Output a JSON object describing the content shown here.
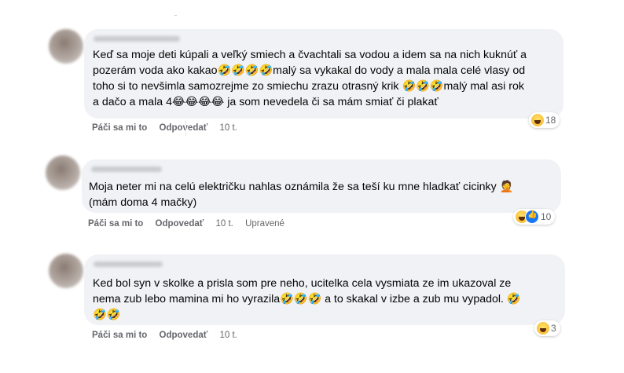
{
  "comments": [
    {
      "text": "Keď sa moje deti kúpali a veľký smiech a čvachtali sa vodou a idem sa na nich kuknúť a\npozerám voda ako kakao🤣🤣🤣🤣malý sa vykakal do vody a mala mala celé vlasy od\ntoho si to nevšimla samozrejme zo smiechu zrazu otrasný krik 🤣🤣🤣malý mal asi rok\na dačo a mala 4😂😂😂😂 ja som nevedela či sa mám smiať či plakať",
      "like_label": "Páči sa mi to",
      "reply_label": "Odpovedať",
      "time": "10 t.",
      "edited": "",
      "reaction_icons": [
        "haha-icon"
      ],
      "reaction_count": "18"
    },
    {
      "text": "Moja neter mi na celú električku nahlas oznámila že sa teší ku mne hladkať cicinky 🤦\n(mám doma 4 mačky)",
      "like_label": "Páči sa mi to",
      "reply_label": "Odpovedať",
      "time": "10 t.",
      "edited": "Upravené",
      "reaction_icons": [
        "haha-icon",
        "like-icon"
      ],
      "reaction_count": "10"
    },
    {
      "text": "Ked bol syn v skolke a prisla som pre neho, ucitelka cela vysmiata ze im ukazoval ze\nnema zub lebo mamina mi ho vyrazila🤣🤣🤣 a to skakal v izbe a zub mu vypadol. 🤣\n🤣🤣",
      "like_label": "Páči sa mi to",
      "reply_label": "Odpovedať",
      "time": "10 t.",
      "edited": "",
      "reaction_icons": [
        "haha-icon"
      ],
      "reaction_count": "3"
    }
  ],
  "colors": {
    "bubble": "#f0f2f5",
    "meta_text": "#65676b",
    "body_text": "#050505",
    "like_blue": "#1877f2",
    "haha_yellow": "#f7b125"
  }
}
